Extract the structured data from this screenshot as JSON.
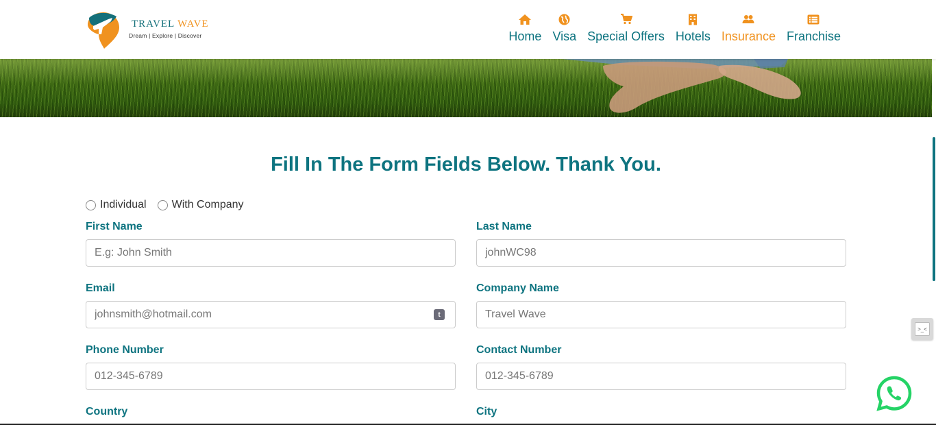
{
  "brand": {
    "name_part1": "TRAVEL ",
    "name_part2": "WAVE",
    "tagline": "Dream | Explore | Discover"
  },
  "nav": {
    "items": [
      {
        "label": "Home",
        "icon": "home-icon",
        "active": false
      },
      {
        "label": "Visa",
        "icon": "globe-icon",
        "active": false
      },
      {
        "label": "Special Offers",
        "icon": "cart-icon",
        "active": false
      },
      {
        "label": "Hotels",
        "icon": "building-icon",
        "active": false
      },
      {
        "label": "Insurance",
        "icon": "users-icon",
        "active": true
      },
      {
        "label": "Franchise",
        "icon": "list-icon",
        "active": false
      }
    ]
  },
  "form": {
    "heading": "Fill In The Form Fields Below. Thank You.",
    "radio_individual": "Individual",
    "radio_company": "With Company",
    "first_name": {
      "label": "First Name",
      "placeholder": "E.g: John Smith"
    },
    "last_name": {
      "label": "Last Name",
      "placeholder": "johnWC98"
    },
    "email": {
      "label": "Email",
      "placeholder": "johnsmith@hotmail.com",
      "badge": "t"
    },
    "company_name": {
      "label": "Company Name",
      "placeholder": "Travel Wave"
    },
    "phone": {
      "label": "Phone Number",
      "placeholder": "012-345-6789"
    },
    "contact": {
      "label": "Contact Number",
      "placeholder": "012-345-6789"
    },
    "country": {
      "label": "Country"
    },
    "city": {
      "label": "City"
    }
  },
  "colors": {
    "primary": "#0e7480",
    "accent": "#f0921f",
    "whatsapp": "#25d366"
  }
}
